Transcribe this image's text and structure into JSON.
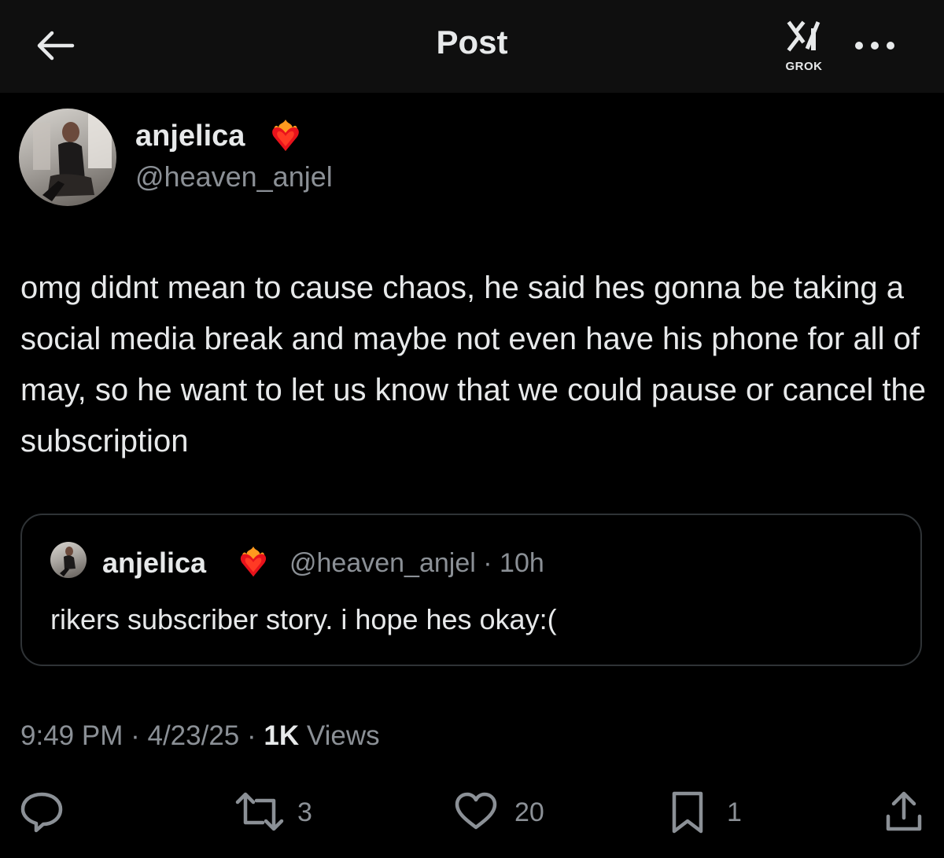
{
  "header": {
    "title": "Post",
    "grok_label": "GROK"
  },
  "author": {
    "display_name": "anjelica",
    "handle": "@heaven_anjel"
  },
  "post": {
    "text": "omg didnt mean to cause chaos, he said hes gonna be taking a social media break and maybe not even have his phone for all of may, so he want to let us know that we could pause or cancel the subscription"
  },
  "quoted_post": {
    "display_name": "anjelica",
    "handle": "@heaven_anjel",
    "separator": "·",
    "age": "10h",
    "text": "rikers subscriber story. i hope hes okay:("
  },
  "meta": {
    "time": "9:49 PM",
    "date": "4/23/25",
    "separator": "·",
    "views_count": "1K",
    "views_label": "Views"
  },
  "actions": {
    "reposts": "3",
    "likes": "20",
    "bookmarks": "1"
  },
  "icons": {
    "back": "arrow-left-icon",
    "grok": "grok-icon",
    "more": "more-horizontal-icon",
    "reply": "reply-icon",
    "repost": "repost-icon",
    "like": "heart-icon",
    "bookmark": "bookmark-icon",
    "share": "share-icon",
    "emoji": "heart-on-fire-emoji"
  },
  "colors": {
    "background": "#000000",
    "header_background": "#0f0f0f",
    "primary_text": "#e7e9ea",
    "secondary_text": "#8b9096",
    "border": "#2f3336"
  }
}
